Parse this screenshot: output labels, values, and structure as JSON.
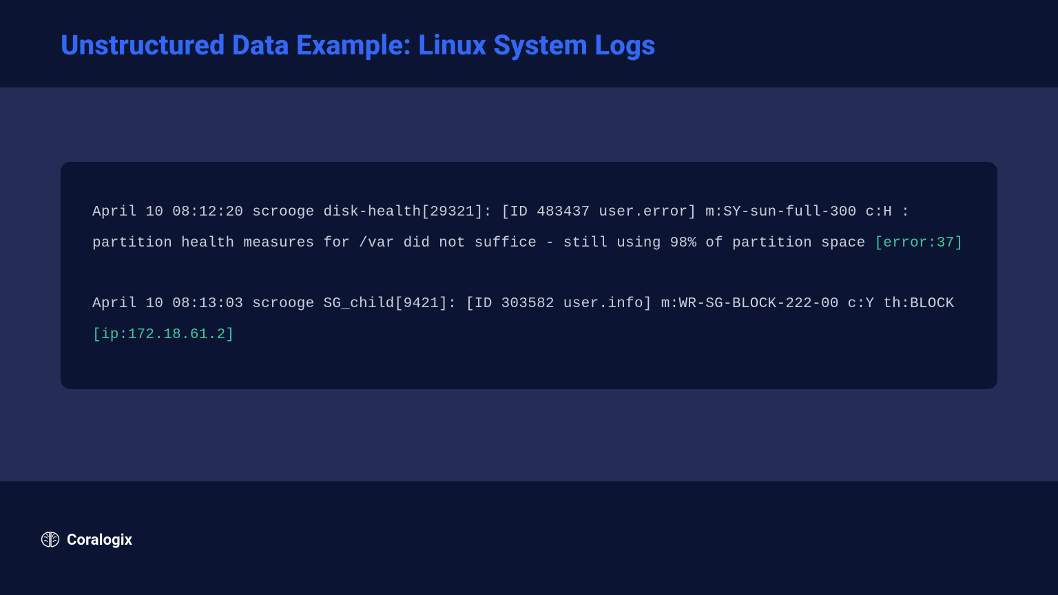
{
  "header": {
    "title": "Unstructured Data Example: Linux System Logs"
  },
  "logs": {
    "entry1": {
      "pre": "April 10 08:12:20 scrooge disk-health[29321]: [ID 483437 user.error] m:SY-sun-full-300 c:H : partition health measures for /var did not suffice - still using 98% of partition space ",
      "hl": "[error:37]"
    },
    "entry2": {
      "pre": "April 10 08:13:03 scrooge SG_child[9421]: [ID 303582 user.info] m:WR-SG-BLOCK-222-00 c:Y th:BLOCK ",
      "hl": "[ip:172.18.61.2]"
    }
  },
  "footer": {
    "brand": "Coralogix"
  }
}
